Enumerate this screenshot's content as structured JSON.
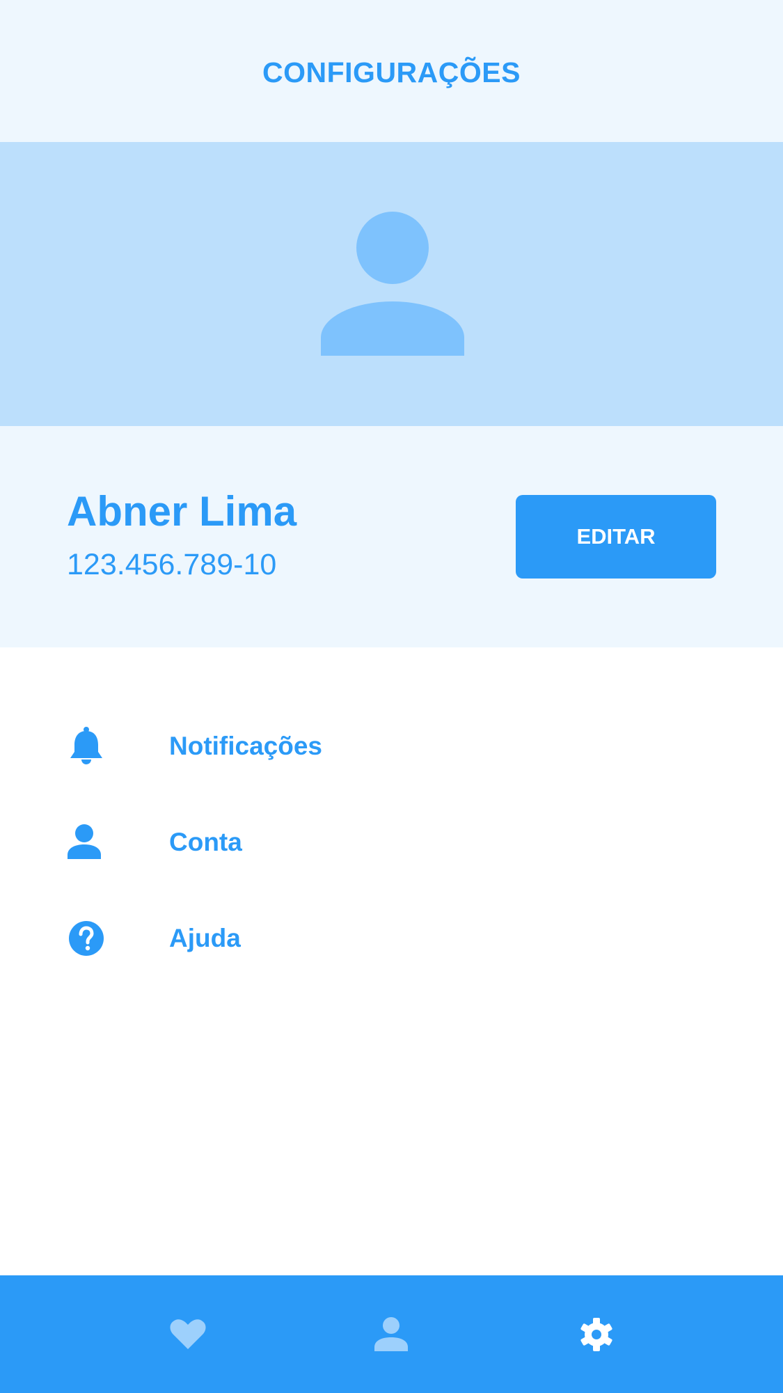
{
  "header": {
    "title": "CONFIGURAÇÕES"
  },
  "avatar": {
    "icon": "user-placeholder-icon"
  },
  "profile": {
    "name": "Abner Lima",
    "document": "123.456.789-10",
    "edit_label": "EDITAR"
  },
  "menu": {
    "items": [
      {
        "icon": "bell-icon",
        "label": "Notificações"
      },
      {
        "icon": "user-icon",
        "label": "Conta"
      },
      {
        "icon": "help-icon",
        "label": "Ajuda"
      }
    ]
  },
  "bottom_nav": {
    "items": [
      {
        "icon": "heart-icon",
        "active": false
      },
      {
        "icon": "user-icon",
        "active": false
      },
      {
        "icon": "gear-icon",
        "active": true
      }
    ]
  },
  "colors": {
    "primary": "#2b9af7",
    "header_bg": "#eef7fe",
    "banner_bg": "#bcdffc",
    "avatar": "#7ec2fd",
    "inactive_nav_icon": "#9dd0fc",
    "active_nav_icon": "#ffffff"
  }
}
